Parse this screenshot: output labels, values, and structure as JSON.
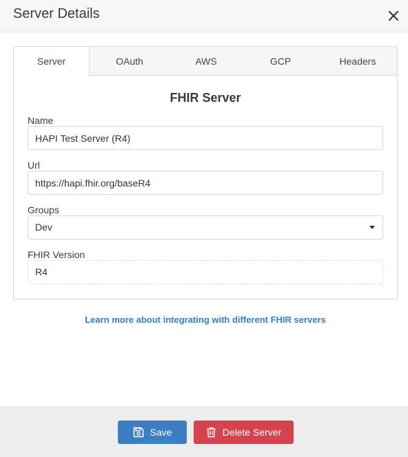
{
  "dialog": {
    "title": "Server Details",
    "close_icon": "close-icon"
  },
  "tabs": [
    {
      "label": "Server",
      "active": true
    },
    {
      "label": "OAuth",
      "active": false
    },
    {
      "label": "AWS",
      "active": false
    },
    {
      "label": "GCP",
      "active": false
    },
    {
      "label": "Headers",
      "active": false
    }
  ],
  "form": {
    "section_title": "FHIR Server",
    "name": {
      "label": "Name",
      "value": "HAPI Test Server (R4)"
    },
    "url": {
      "label": "Url",
      "value": "https://hapi.fhir.org/baseR4"
    },
    "groups": {
      "label": "Groups",
      "value": "Dev"
    },
    "fhir_version": {
      "label": "FHIR Version",
      "value": "R4"
    }
  },
  "learn_link": "Learn more about integrating with different FHIR servers",
  "footer": {
    "save_label": "Save",
    "save_icon": "floppy-disk-icon",
    "delete_label": "Delete Server",
    "delete_icon": "trash-icon"
  },
  "colors": {
    "save_button": "#3b7ec4",
    "delete_button": "#d6434f",
    "link": "#2f7fd6"
  }
}
